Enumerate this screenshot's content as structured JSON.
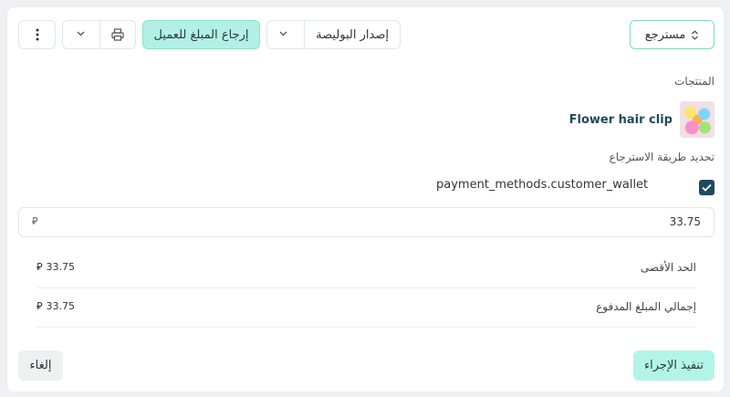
{
  "header": {
    "status_label": "مسترجع",
    "issue_policy_label": "إصدار البوليصة",
    "refund_label": "إرجاع المبلغ للعميل"
  },
  "icons": {
    "status_toggle": "up-down-chevron-icon",
    "issue_dropdown": "chevron-down-icon",
    "print_dropdown": "chevron-down-icon",
    "print": "printer-icon",
    "more": "vertical-dots-icon",
    "checkbox": "check-icon",
    "currency": "riyal-icon"
  },
  "products": {
    "label": "المنتجات",
    "items": [
      {
        "name": "Flower hair clip"
      }
    ]
  },
  "refund_method": {
    "label": "تحديد طريقة الاسترجاع",
    "option_label": "payment_methods.customer_wallet",
    "checked": true,
    "amount_value": "33.75"
  },
  "summary": {
    "max_label": "الحد الأقصى",
    "max_value": "33.75",
    "total_label": "إجمالي المبلغ المدفوع",
    "total_value": "33.75",
    "currency_symbol": "⃁"
  },
  "footer": {
    "execute_label": "تنفيذ الإجراء",
    "cancel_label": "إلغاء"
  },
  "colors": {
    "accent": "#b2f0e4",
    "accent_border": "#7fd8c7",
    "checkbox": "#1f4a5c",
    "product_text": "#1f4a5c"
  }
}
